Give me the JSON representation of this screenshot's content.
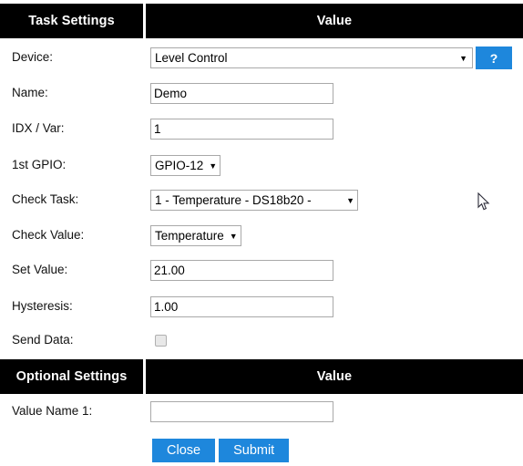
{
  "theme": {
    "accent": "#1e87dc",
    "header_bg": "#000000",
    "header_text": "#ffffff",
    "page_bg": "#ffffff",
    "input_border": "#a9a9a9"
  },
  "sections": [
    {
      "header": {
        "left": "Task Settings",
        "right": "Value"
      }
    },
    {
      "header": {
        "left": "Optional Settings",
        "right": "Value"
      }
    }
  ],
  "task_settings": {
    "header_left": "Task Settings",
    "header_right": "Value",
    "device": {
      "label": "Device:",
      "value": "Level Control",
      "caret": "▼",
      "help_label": "?"
    },
    "name": {
      "label": "Name:",
      "value": "Demo",
      "placeholder": ""
    },
    "idx_var": {
      "label": "IDX / Var:",
      "value": "1",
      "placeholder": ""
    },
    "first_gpio": {
      "label": "1st GPIO:",
      "value": "GPIO-12",
      "caret": "▼"
    },
    "check_task": {
      "label": "Check Task:",
      "value": "1 - Temperature - DS18b20 -",
      "caret": "▼"
    },
    "check_value": {
      "label": "Check Value:",
      "value": "Temperature",
      "caret": "▼"
    },
    "set_value": {
      "label": "Set Value:",
      "value": "21.00",
      "placeholder": ""
    },
    "hysteresis": {
      "label": "Hysteresis:",
      "value": "1.00",
      "placeholder": ""
    },
    "send_data": {
      "label": "Send Data:",
      "checked": false
    }
  },
  "optional_settings": {
    "header_left": "Optional Settings",
    "header_right": "Value",
    "value_name_1": {
      "label": "Value Name 1:",
      "value": "",
      "placeholder": ""
    }
  },
  "actions": {
    "close_label": "Close",
    "submit_label": "Submit"
  }
}
